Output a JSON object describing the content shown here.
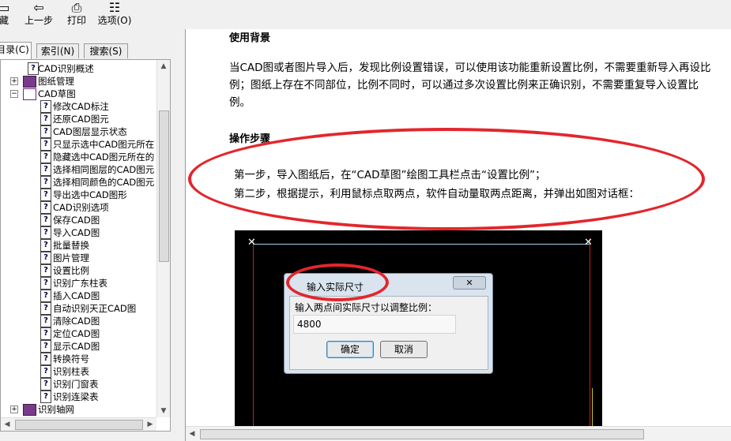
{
  "toolbar": {
    "buttons": [
      {
        "label": "藏",
        "icon": "favorites-icon"
      },
      {
        "label": "上一步",
        "icon": "back-arrow-icon"
      },
      {
        "label": "打印",
        "icon": "printer-icon"
      },
      {
        "label": "选项(O)",
        "icon": "options-icon"
      }
    ]
  },
  "tabs": [
    {
      "label": "目录(C)"
    },
    {
      "label": "索引(N)"
    },
    {
      "label": "搜索(S)"
    }
  ],
  "tree": [
    {
      "label": "CAD识别概述",
      "kind": "page",
      "level": 2
    },
    {
      "label": "图纸管理",
      "kind": "book",
      "level": 1,
      "expander": "+"
    },
    {
      "label": "CAD草图",
      "kind": "book-open",
      "level": 1,
      "expander": "−"
    },
    {
      "label": "修改CAD标注",
      "kind": "page",
      "level": 3
    },
    {
      "label": "还原CAD图元",
      "kind": "page",
      "level": 3
    },
    {
      "label": "CAD图层显示状态",
      "kind": "page",
      "level": 3
    },
    {
      "label": "只显示选中CAD图元所在",
      "kind": "page",
      "level": 3
    },
    {
      "label": "隐藏选中CAD图元所在的",
      "kind": "page",
      "level": 3
    },
    {
      "label": "选择相同图层的CAD图元",
      "kind": "page",
      "level": 3
    },
    {
      "label": "选择相同颜色的CAD图元",
      "kind": "page",
      "level": 3
    },
    {
      "label": "导出选中CAD图形",
      "kind": "page",
      "level": 3
    },
    {
      "label": "CAD识别选项",
      "kind": "page",
      "level": 3
    },
    {
      "label": "保存CAD图",
      "kind": "page",
      "level": 3
    },
    {
      "label": "导入CAD图",
      "kind": "page",
      "level": 3
    },
    {
      "label": "批量替换",
      "kind": "page",
      "level": 3
    },
    {
      "label": "图片管理",
      "kind": "page",
      "level": 3
    },
    {
      "label": "设置比例",
      "kind": "page",
      "level": 3
    },
    {
      "label": "识别广东柱表",
      "kind": "page",
      "level": 3
    },
    {
      "label": "插入CAD图",
      "kind": "page",
      "level": 3
    },
    {
      "label": "自动识别天正CAD图",
      "kind": "page",
      "level": 3
    },
    {
      "label": "清除CAD图",
      "kind": "page",
      "level": 3
    },
    {
      "label": "定位CAD图",
      "kind": "page",
      "level": 3
    },
    {
      "label": "显示CAD图",
      "kind": "page",
      "level": 3
    },
    {
      "label": "转换符号",
      "kind": "page",
      "level": 3
    },
    {
      "label": "识别柱表",
      "kind": "page",
      "level": 3
    },
    {
      "label": "识别门窗表",
      "kind": "page",
      "level": 3
    },
    {
      "label": "识别连梁表",
      "kind": "page",
      "level": 3
    },
    {
      "label": "识别轴网",
      "kind": "book",
      "level": 1,
      "expander": "+"
    }
  ],
  "content": {
    "heading1": "使用背景",
    "paragraph1": "当CAD图或者图片导入后，发现比例设置错误，可以使用该功能重新设置比例，不需要重新导入再设比例；图纸上存在不同部位，比例不同时，可以通过多次设置比例来正确识别，不需要重复导入设置比例。",
    "heading2": "操作步骤",
    "step1": "第一步，导入图纸后，在“CAD草图”绘图工具栏点击“设置比例”；",
    "step2": "第二步，根据提示，利用鼠标点取两点，软件自动量取两点距离，并弹出如图对话框："
  },
  "dialog": {
    "title": "输入实际尺寸",
    "close": "✕",
    "prompt": "输入两点间实际尺寸以调整比例：",
    "value": "4800",
    "ok": "确定",
    "cancel": "取消"
  },
  "colors": {
    "annotation_red": "#e3262c",
    "cad_background": "#000000"
  }
}
